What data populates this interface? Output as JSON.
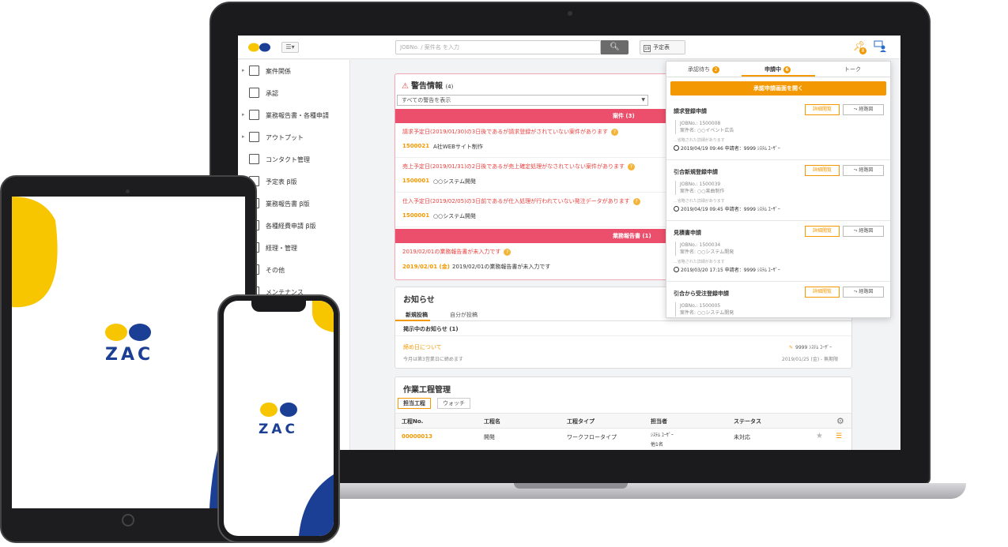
{
  "topbar": {
    "search_placeholder": "JOBNo. / 案件名 を入力",
    "schedule_label": "予定表",
    "calendar_day": "19",
    "pin_badge": "8"
  },
  "sidebar": {
    "items": [
      {
        "label": "案件関係",
        "caret": true
      },
      {
        "label": "承認",
        "caret": false
      },
      {
        "label": "業務報告書・各種申請",
        "caret": true
      },
      {
        "label": "アウトプット",
        "caret": true
      },
      {
        "label": "コンタクト管理",
        "caret": false
      },
      {
        "label": "予定表 β版",
        "caret": false
      },
      {
        "label": "業務報告書 β版",
        "caret": false
      },
      {
        "label": "各種経費申請 β版",
        "caret": false
      },
      {
        "label": "経理・管理",
        "caret": false
      },
      {
        "label": "その他",
        "caret": false
      },
      {
        "label": "メンテナンス",
        "caret": false
      }
    ]
  },
  "warnings": {
    "title": "警告情報",
    "count": "(4)",
    "filter": "すべての警告を表示",
    "section1": "案件 (3)",
    "section2": "業務報告書 (1)",
    "items": [
      {
        "msg": "請求予定日(2019/01/30)の3日後であるが請求登録がされていない案件があります",
        "code": "1500021",
        "name": "A社WEBサイト制作"
      },
      {
        "msg": "売上予定日(2019/01/31)の2日後であるが売上確定処理がなされていない案件があります",
        "code": "1500001",
        "name": "○○システム開発"
      },
      {
        "msg": "仕入予定日(2019/02/05)の3日前であるが仕入処理が行われていない発注データがあります",
        "code": "1500001",
        "name": "○○システム開発"
      },
      {
        "msg": "2019/02/01の業務報告書が未入力です",
        "code": "2019/02/01 (金)",
        "name": "2019/02/01の業務報告書が未入力です"
      }
    ]
  },
  "news": {
    "title": "お知らせ",
    "tab_new": "新規投稿",
    "tab_mine": "自分が投稿",
    "subheading": "掲示中のお知らせ (1)",
    "item_title": "締め日について",
    "item_body": "今月は第3営業日に締めます",
    "author": "9999 ｼｽﾃﾑ ﾕｰｻﾞｰ",
    "date": "2019/01/25 (金) - 無期限"
  },
  "process": {
    "title": "作業工程管理",
    "tab_assigned": "担当工程",
    "tab_watch": "ウォッチ",
    "columns": [
      "工程No.",
      "工程名",
      "工程タイプ",
      "担当者",
      "ステータス"
    ],
    "row": {
      "no": "00000013",
      "name": "開発",
      "type": "ワークフロータイプ",
      "assignee": "ｼｽﾃﾑ ﾕｰｻﾞｰ",
      "assignee2": "他1名",
      "status": "未対応"
    }
  },
  "approval_popup": {
    "tab_waiting": "承認待ち",
    "tab_waiting_badge": "2",
    "tab_applying": "申請中",
    "tab_applying_badge": "6",
    "tab_talk": "トーク",
    "open_button": "承認申請画面を開く",
    "detail_label": "詳細閲覧",
    "route_label": "経路図",
    "more_text": "...省略された詳細があります",
    "requests": [
      {
        "title": "請求登録申請",
        "job": "JOBNo.: 1500008",
        "case": "案件名: ○○イベント広告",
        "meta": "2019/04/19 09:46  申請者：9999 ｼｽﾃﾑ ﾕｰｻﾞｰ"
      },
      {
        "title": "引合新規登録申請",
        "job": "JOBNo.: 1500039",
        "case": "案件名: ○○楽曲制作",
        "meta": "2019/04/19 09:45  申請者：9999 ｼｽﾃﾑ ﾕｰｻﾞｰ"
      },
      {
        "title": "見積書申請",
        "job": "JOBNo.: 1500034",
        "case": "案件名: ○○システム開発",
        "meta": "2019/03/20 17:15  申請者：9999 ｼｽﾃﾑ ﾕｰｻﾞｰ"
      },
      {
        "title": "引合から受注登録申請",
        "job": "JOBNo.: 1500005",
        "case": "案件名: ○○システム開発",
        "meta": ""
      }
    ]
  },
  "brand": {
    "tablet_logo": "ZAC",
    "phone_logo": "ZAC",
    "yellow": "#f7c600",
    "blue": "#1a3f94",
    "accent": "#f39800",
    "alert": "#ec4f6b"
  }
}
